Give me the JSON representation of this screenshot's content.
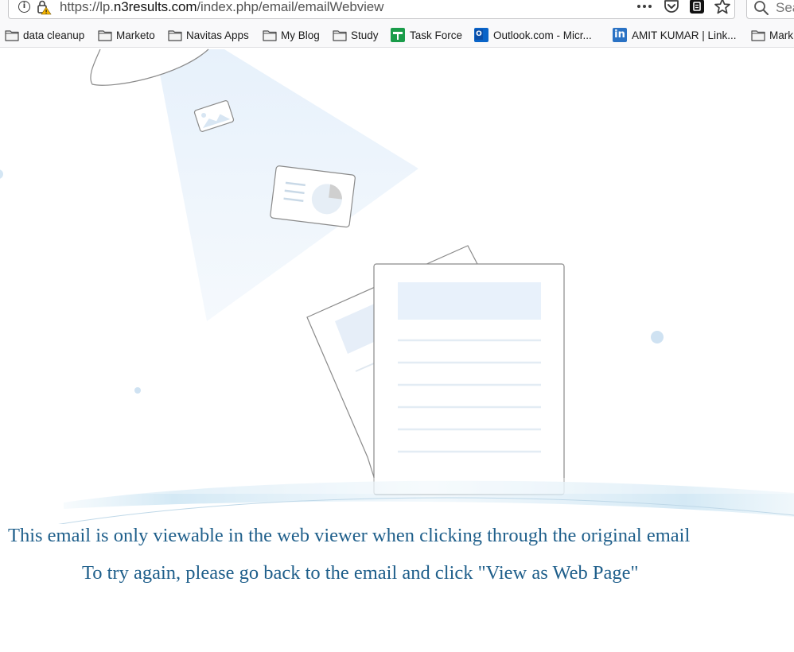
{
  "browser": {
    "url_prefix": "https://lp.",
    "url_host": "n3results.com",
    "url_path": "/index.php/email/emailWebview",
    "search_placeholder": "Sea"
  },
  "bookmarks": [
    {
      "label": "data cleanup",
      "icon": "folder-icon"
    },
    {
      "label": "Marketo",
      "icon": "folder-icon"
    },
    {
      "label": "Navitas Apps",
      "icon": "folder-icon"
    },
    {
      "label": "My Blog",
      "icon": "folder-icon"
    },
    {
      "label": "Study",
      "icon": "folder-icon"
    },
    {
      "label": "Task Force",
      "icon": "task-force-icon"
    },
    {
      "label": "Outlook.com - Micr...",
      "icon": "outlook-icon"
    },
    {
      "label": "AMIT KUMAR | Link...",
      "icon": "linkedin-icon"
    },
    {
      "label": "Mark",
      "icon": "folder-icon"
    }
  ],
  "message": {
    "line1": "This email is only viewable in the web viewer when clicking through the original email",
    "line2": "To try again, please go back to the email and click \"View as Web Page\""
  },
  "colors": {
    "message_text": "#1f5f8b",
    "illustration_light_blue": "#e8f2fb",
    "illustration_stroke": "#8a8a8a"
  }
}
